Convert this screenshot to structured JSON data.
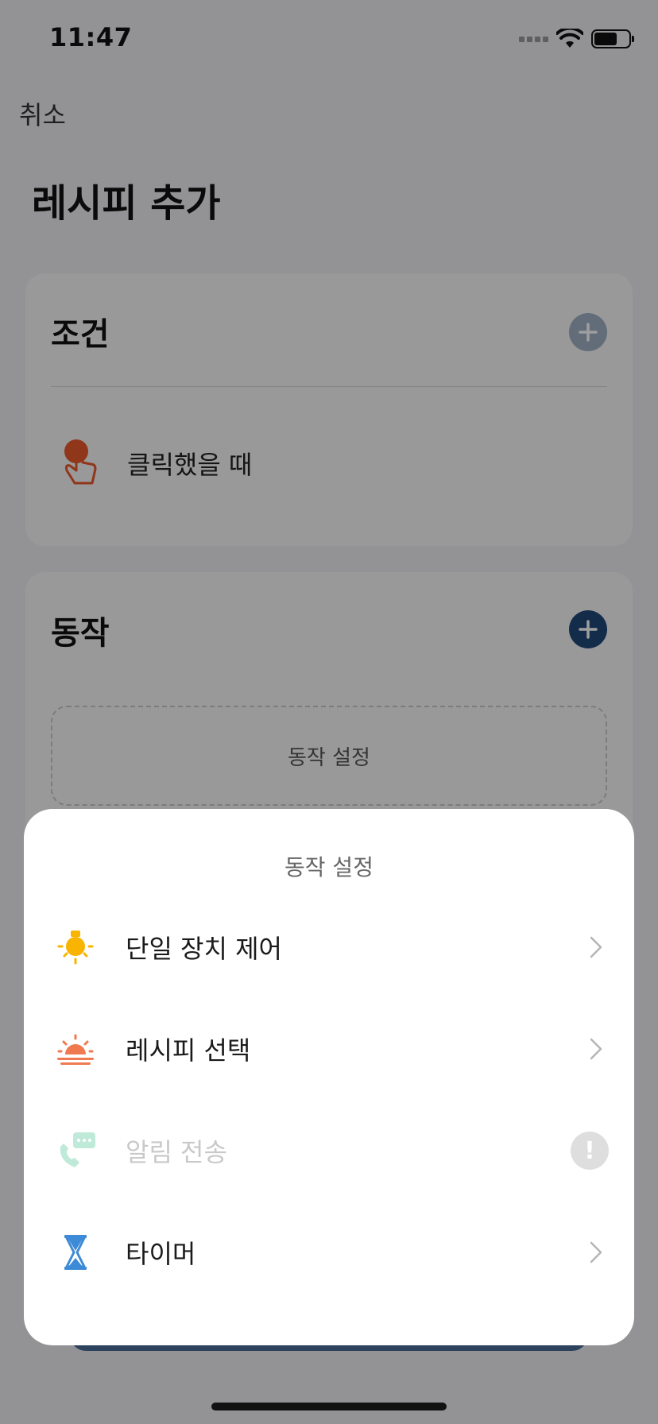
{
  "status_bar": {
    "time": "11:47"
  },
  "nav": {
    "cancel_label": "취소",
    "title": "레시피 추가"
  },
  "condition_section": {
    "title": "조건",
    "item_label": "클릭했을 때"
  },
  "action_section": {
    "title": "동작",
    "placeholder": "동작 설정"
  },
  "sheet": {
    "title": "동작 설정",
    "options": [
      {
        "label": "단일 장치 제어",
        "icon": "bulb-icon",
        "enabled": true
      },
      {
        "label": "레시피 선택",
        "icon": "sunrise-icon",
        "enabled": true
      },
      {
        "label": "알림 전송",
        "icon": "phone-message-icon",
        "enabled": false
      },
      {
        "label": "타이머",
        "icon": "hourglass-icon",
        "enabled": true
      }
    ]
  },
  "colors": {
    "accent": "#1f4777",
    "bulb": "#f8b400",
    "sunrise": "#f07a50",
    "hourglass": "#3d8ad6",
    "notify_disabled": "#bfe9d8"
  }
}
